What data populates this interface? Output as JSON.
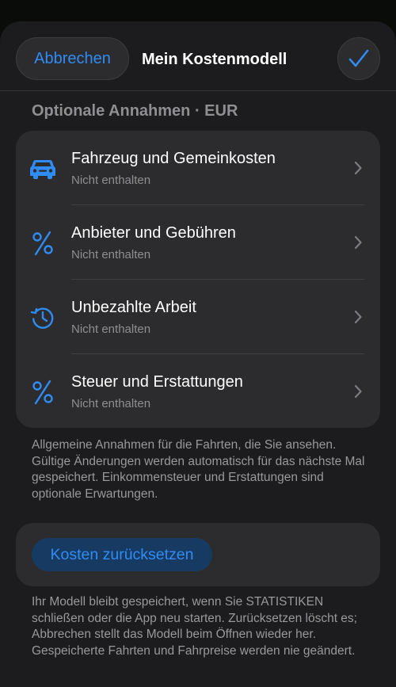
{
  "nav": {
    "cancel_label": "Abbrechen",
    "title": "Mein Kostenmodell",
    "done_icon": "checkmark-icon"
  },
  "section": {
    "header": "Optionale Annahmen · EUR"
  },
  "items": [
    {
      "icon": "car-icon",
      "title": "Fahrzeug und Gemeinkosten",
      "subtitle": "Nicht enthalten"
    },
    {
      "icon": "percent-icon",
      "title": "Anbieter und Gebühren",
      "subtitle": "Nicht enthalten"
    },
    {
      "icon": "history-clock-icon",
      "title": "Unbezahlte Arbeit",
      "subtitle": "Nicht enthalten"
    },
    {
      "icon": "percent-icon",
      "title": "Steuer und Erstattungen",
      "subtitle": "Nicht enthalten"
    }
  ],
  "footnote1": "Allgemeine Annahmen für die Fahrten, die Sie ansehen. Gültige Änderungen werden automatisch für das nächste Mal gespeichert. Einkommensteuer und Erstattungen sind optionale Erwartungen.",
  "reset": {
    "label": "Kosten zurücksetzen"
  },
  "footnote2": "Ihr Modell bleibt gespeichert, wenn Sie STATISTIKEN schließen oder die App neu starten. Zurücksetzen löscht es; Abbrechen stellt das Modell beim Öffnen wieder her. Gespeicherte Fahrten und Fahrpreise werden nie geändert.",
  "colors": {
    "accent": "#2f8cf5",
    "background": "#1c1c1e",
    "card": "#2c2c2e",
    "secondary_text": "#8e8e93"
  }
}
